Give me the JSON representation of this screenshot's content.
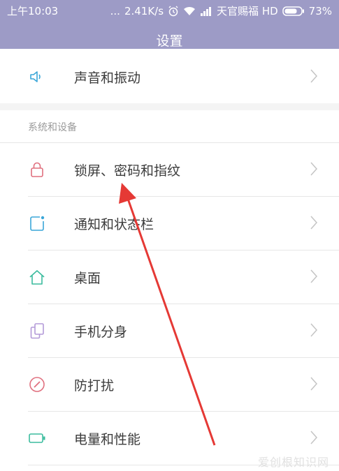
{
  "status_bar": {
    "time": "上午10:03",
    "signal_dots": "...",
    "net_speed": "2.41K/s",
    "carrier": "天官赐福 HD",
    "battery": "73%"
  },
  "header": {
    "title": "设置"
  },
  "top_item": {
    "label": "声音和振动"
  },
  "section": {
    "title": "系统和设备",
    "items": [
      {
        "label": "锁屏、密码和指纹",
        "icon": "lock-icon",
        "color": "#e0707f"
      },
      {
        "label": "通知和状态栏",
        "icon": "notification-icon",
        "color": "#3aa6d8"
      },
      {
        "label": "桌面",
        "icon": "home-icon",
        "color": "#3cbc9e"
      },
      {
        "label": "手机分身",
        "icon": "clone-icon",
        "color": "#b39ad8"
      },
      {
        "label": "防打扰",
        "icon": "do-not-disturb-icon",
        "color": "#e0707f"
      },
      {
        "label": "电量和性能",
        "icon": "battery-icon",
        "color": "#3cbc9e"
      }
    ]
  },
  "colors": {
    "header_bg": "#9d9bc6",
    "arrow": "#e53935"
  },
  "watermark": "爱创根知识网"
}
